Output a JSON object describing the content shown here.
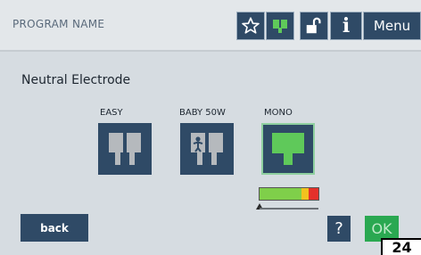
{
  "header": {
    "program_name": "PROGRAM NAME",
    "icons": [
      "star-icon",
      "grid-icon",
      "lock-icon",
      "info-icon"
    ],
    "info_label": "i",
    "menu_label": "Menu"
  },
  "main": {
    "title": "Neutral Electrode",
    "options": [
      {
        "label": "EASY",
        "icon": "split-electrode-icon",
        "selected": false
      },
      {
        "label": "BABY 50W",
        "icon": "baby-electrode-icon",
        "selected": false
      },
      {
        "label": "MONO",
        "icon": "mono-electrode-icon",
        "selected": true
      }
    ],
    "level_meter": {
      "level_fraction": 0.0,
      "colors": [
        "#7fcf4a",
        "#f2c21f",
        "#e4312b"
      ]
    }
  },
  "footer": {
    "back_label": "back",
    "help_label": "?",
    "ok_label": "OK"
  },
  "figure_number": "24",
  "colors": {
    "button": "#2f4a66",
    "ok": "#2aa851",
    "background": "#d6dce1",
    "mono_icon": "#5fc95a",
    "icon_gray": "#b5b9bd"
  }
}
